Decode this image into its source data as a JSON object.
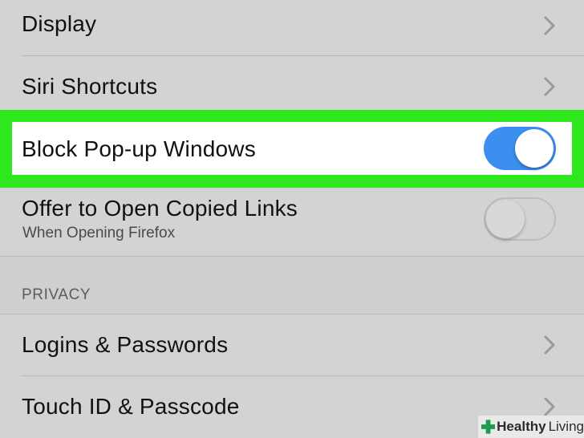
{
  "settings": {
    "display": {
      "label": "Display"
    },
    "siri_shortcuts": {
      "label": "Siri Shortcuts"
    },
    "block_popups": {
      "label": "Block Pop-up Windows",
      "enabled": true
    },
    "offer_copied_links": {
      "label": "Offer to Open Copied Links",
      "sublabel": "When Opening Firefox",
      "enabled": false
    },
    "privacy_header": "PRIVACY",
    "logins_passwords": {
      "label": "Logins & Passwords"
    },
    "touch_id": {
      "label": "Touch ID & Passcode"
    }
  },
  "colors": {
    "highlight": "#2ee71d",
    "toggle_on": "#3a8ff0"
  },
  "watermark": {
    "brand_bold": "Healthy",
    "brand_light": "Living",
    "icon": "plus-cross-icon"
  }
}
